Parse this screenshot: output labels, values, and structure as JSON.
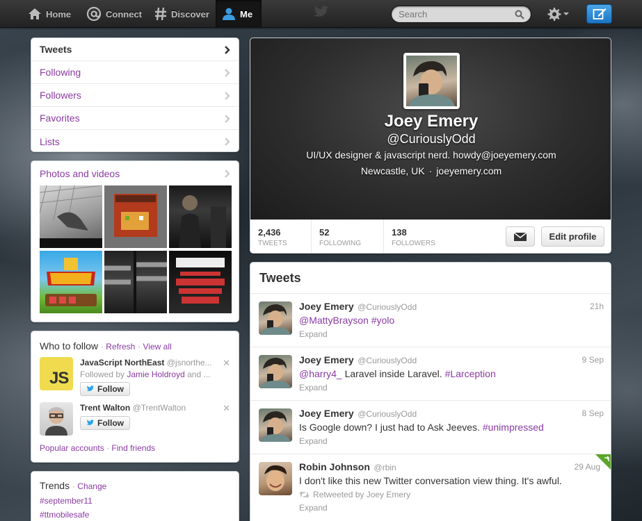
{
  "topbar": {
    "nav": {
      "home": "Home",
      "connect": "Connect",
      "discover": "Discover",
      "me": "Me"
    },
    "search_placeholder": "Search"
  },
  "sidebar": {
    "nav_items": [
      {
        "label": "Tweets"
      },
      {
        "label": "Following"
      },
      {
        "label": "Followers"
      },
      {
        "label": "Favorites"
      },
      {
        "label": "Lists"
      }
    ],
    "photos_title": "Photos and videos",
    "who_to_follow": {
      "title": "Who to follow",
      "refresh": "Refresh",
      "view_all": "View all",
      "suggestions": [
        {
          "name": "JavaScript NorthEast",
          "handle": "@jsnorthe...",
          "followed_by_prefix": "Followed by",
          "followed_by_name": "Jamie Holdroyd",
          "followed_by_suffix": "and ...",
          "avatar_text": "JS",
          "follow_label": "Follow"
        },
        {
          "name": "Trent Walton",
          "handle": "@TrentWalton",
          "follow_label": "Follow"
        }
      ],
      "dismiss": "✕",
      "popular_accounts": "Popular accounts",
      "find_friends": "Find friends"
    },
    "trends": {
      "title": "Trends",
      "change": "Change",
      "items": [
        "#september11",
        "#ttmobilesafe"
      ]
    }
  },
  "profile": {
    "name": "Joey Emery",
    "handle": "@CuriouslyOdd",
    "bio": "UI/UX designer & javascript nerd. howdy@joeyemery.com",
    "location": "Newcastle, UK",
    "website": "joeyemery.com",
    "stats": [
      {
        "value": "2,436",
        "label": "TWEETS"
      },
      {
        "value": "52",
        "label": "FOLLOWING"
      },
      {
        "value": "138",
        "label": "FOLLOWERS"
      }
    ],
    "edit_profile": "Edit profile"
  },
  "stream": {
    "title": "Tweets",
    "tweets": [
      {
        "name": "Joey Emery",
        "handle": "@CuriouslyOdd",
        "time": "21h",
        "mention": "@MattyBrayson",
        "text": " ",
        "hashtag": "#yolo",
        "action": "Expand"
      },
      {
        "name": "Joey Emery",
        "handle": "@CuriouslyOdd",
        "time": "9 Sep",
        "mention": "@harry4_",
        "text": " Laravel inside Laravel. ",
        "hashtag": "#Larception",
        "action": "Expand"
      },
      {
        "name": "Joey Emery",
        "handle": "@CuriouslyOdd",
        "time": "8 Sep",
        "text": "Is Google down? I just had to Ask Jeeves. ",
        "hashtag": "#unimpressed",
        "action": "Expand"
      },
      {
        "name": "Robin Johnson",
        "handle": "@rbin",
        "time": "29 Aug",
        "text": "I don't like this new Twitter conversation view thing. It's awful.",
        "retweeted_by": "Retweeted by Joey Emery",
        "action": "Expand"
      }
    ]
  },
  "colors": {
    "link": "#8a3aa3",
    "compose_button": "#2b8ad8",
    "retweet_corner": "#5ba528"
  }
}
